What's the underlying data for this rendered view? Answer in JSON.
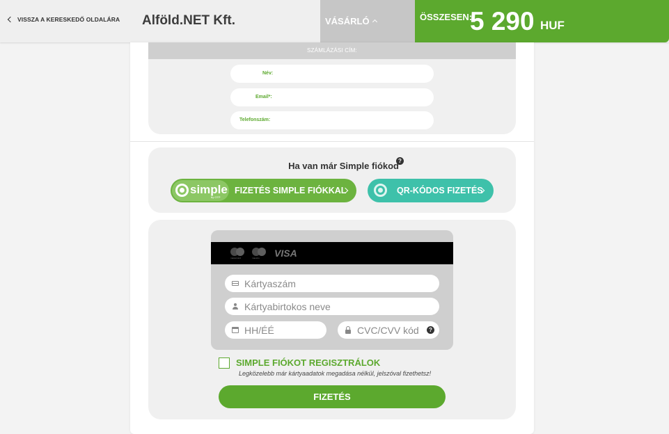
{
  "header": {
    "back_label": "VISSZA A KERESKEDŐ OLDALÁRA",
    "merchant_name": "Alföld.NET Kft.",
    "buyer_tab_label": "VÁSÁRLÓ",
    "total_label": "ÖSSZESEN:",
    "total_amount": "5 290",
    "currency": "HUF"
  },
  "billing": {
    "section_title": "SZÁMLÁZÁSI CÍM:",
    "fields": [
      {
        "label": "Név:",
        "value": ""
      },
      {
        "label": "Email*:",
        "value": ""
      },
      {
        "label": "Telefonszám:",
        "value": ""
      }
    ]
  },
  "simple_account": {
    "title": "Ha van már Simple fiókod",
    "help_icon": "?",
    "logo_text": "simple",
    "logo_sub": "by OTP",
    "simple_button_label": "FIZETÉS SIMPLE FIÓKKAL",
    "qr_button_label": "QR-KÓDOS FIZETÉS"
  },
  "card": {
    "brands": [
      {
        "name": "mastercard",
        "caption": "mastercard"
      },
      {
        "name": "maestro",
        "caption": "maestro"
      },
      {
        "name": "visa",
        "label": "VISA"
      }
    ],
    "card_number_placeholder": "Kártyaszám",
    "card_holder_placeholder": "Kártyabirtokos neve",
    "expiry_placeholder": "HH/ÉÉ",
    "cvc_placeholder": "CVC/CVV kód",
    "cvc_help": "?"
  },
  "register": {
    "checked": false,
    "title": "SIMPLE FIÓKOT REGISZTRÁLOK",
    "subtitle": "Legközelebb már kártyaadatok megadása nélkül, jelszóval fizethetsz!"
  },
  "pay_button_label": "FIZETÉS",
  "colors": {
    "brand_green": "#5ca92e",
    "qr_teal": "#3ec1aa",
    "header_gray": "#c6c6c6"
  }
}
